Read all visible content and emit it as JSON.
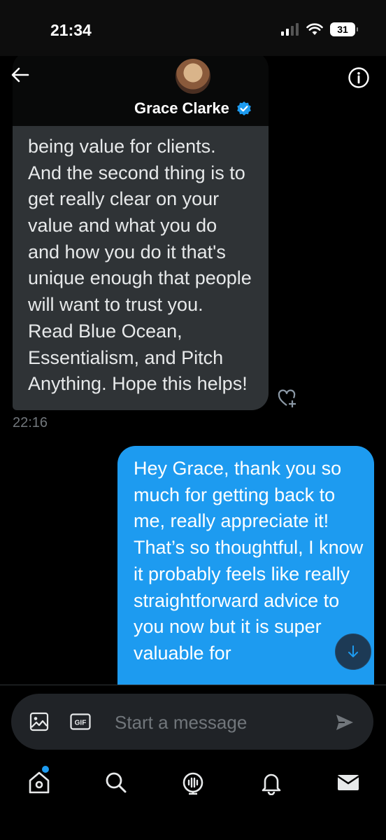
{
  "status_bar": {
    "time": "21:34",
    "battery": "31"
  },
  "header": {
    "contact_name": "Grace Clarke"
  },
  "messages": [
    {
      "direction": "incoming",
      "text": "being value for clients. And the second thing is to get really clear on your value and what you do and how you do it that's unique enough that people will want to trust you. Read Blue Ocean, Essentialism, and Pitch Anything. Hope this helps!",
      "time": "22:16"
    },
    {
      "direction": "outgoing",
      "text": "Hey Grace, thank you so much for getting back to me, really appreciate it! That’s so thoughtful, I know it probably feels like really straightforward advice to you now but it is super valuable for"
    }
  ],
  "composer": {
    "placeholder": "Start a message",
    "gif_label": "GIF"
  },
  "nav": {
    "items": [
      "home-icon",
      "search-icon",
      "spaces-icon",
      "notifications-icon",
      "messages-icon"
    ]
  },
  "colors": {
    "accent": "#1d9bf0",
    "incoming_bubble": "#2f3336",
    "background": "#000000"
  }
}
